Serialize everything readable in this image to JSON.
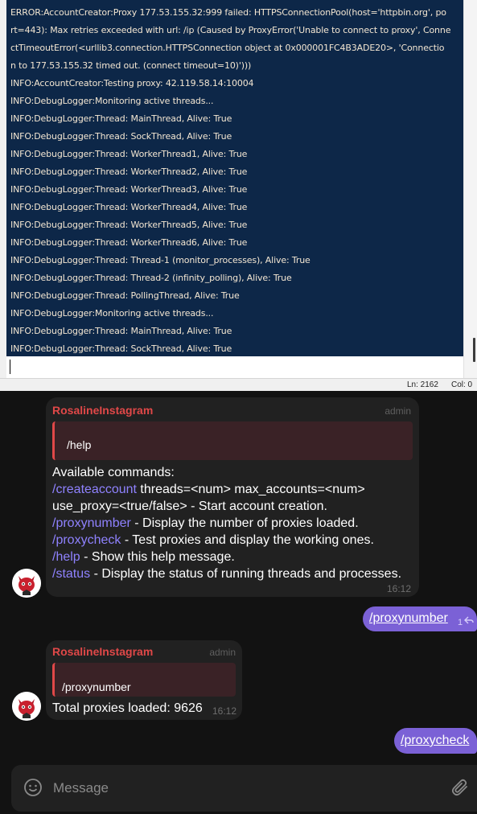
{
  "console": {
    "lines": [
      "ERROR:AccountCreator:Proxy 177.53.155.32:999 failed: HTTPSConnectionPool(host='httpbin.org', po",
      "rt=443): Max retries exceeded with url: /ip (Caused by ProxyError('Unable to connect to proxy', Conne",
      "ctTimeoutError(<urllib3.connection.HTTPSConnection object at 0x000001FC4B3ADE20>, 'Connectio",
      "n to 177.53.155.32 timed out. (connect timeout=10)')))",
      "INFO:AccountCreator:Testing proxy: 42.119.58.14:10004",
      "INFO:DebugLogger:Monitoring active threads...",
      "INFO:DebugLogger:Thread: MainThread, Alive: True",
      "INFO:DebugLogger:Thread: SockThread, Alive: True",
      "INFO:DebugLogger:Thread: WorkerThread1, Alive: True",
      "INFO:DebugLogger:Thread: WorkerThread2, Alive: True",
      "INFO:DebugLogger:Thread: WorkerThread3, Alive: True",
      "INFO:DebugLogger:Thread: WorkerThread4, Alive: True",
      "INFO:DebugLogger:Thread: WorkerThread5, Alive: True",
      "INFO:DebugLogger:Thread: WorkerThread6, Alive: True",
      "INFO:DebugLogger:Thread: Thread-1 (monitor_processes), Alive: True",
      "INFO:DebugLogger:Thread: Thread-2 (infinity_polling), Alive: True",
      "INFO:DebugLogger:Thread: PollingThread, Alive: True",
      "INFO:DebugLogger:Monitoring active threads...",
      "INFO:DebugLogger:Thread: MainThread, Alive: True",
      "INFO:DebugLogger:Thread: SockThread, Alive: True"
    ],
    "status": {
      "line": "Ln: 2162",
      "col": "Col: 0"
    }
  },
  "chat": {
    "messages": [
      {
        "sender": "RosalineInstagram",
        "tag": "admin",
        "reply": "/help",
        "heading": "Available commands:",
        "commands": [
          {
            "cmd": "/createaccount",
            "desc": " threads=<num> max_accounts=<num>"
          },
          {
            "cmd": "",
            "desc": "use_proxy=<true/false> - Start account creation."
          },
          {
            "cmd": "/proxynumber",
            "desc": " - Display the number of proxies loaded."
          },
          {
            "cmd": "/proxycheck",
            "desc": " - Test proxies and display the working ones."
          },
          {
            "cmd": "/help",
            "desc": " - Show this help message."
          },
          {
            "cmd": "/status",
            "desc": " - Display the status of running threads and processes."
          }
        ],
        "time": "16:12"
      },
      {
        "sender": "RosalineInstagram",
        "tag": "admin",
        "reply": "/proxynumber",
        "text": "Total proxies loaded: 9626",
        "time": "16:12"
      }
    ],
    "outgoing": [
      {
        "text": "/proxynumber",
        "meta": "1"
      },
      {
        "text": "/proxycheck"
      }
    ],
    "composer": {
      "placeholder": "Message"
    }
  },
  "colors": {
    "log_bg": "#0d2748",
    "sender": "#e04848",
    "command": "#8f82ff",
    "outgoing_bubble": "#7b61d6"
  },
  "icons": [
    "emoji-icon",
    "attach-icon",
    "reply-arrow-icon",
    "avatar-icon"
  ]
}
